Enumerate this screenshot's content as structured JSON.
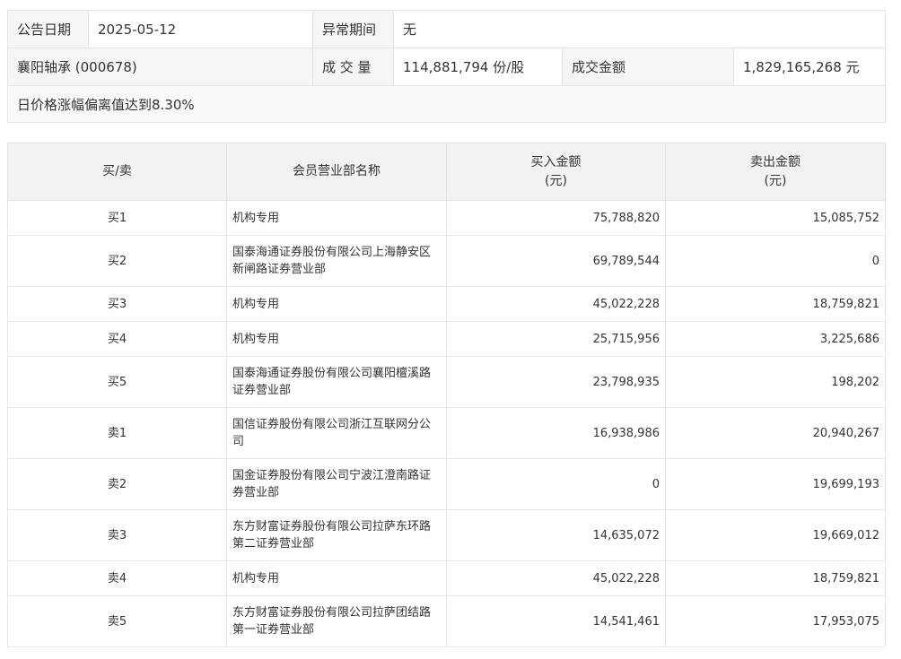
{
  "header": {
    "announce_label": "公告日期",
    "announce_date": "2025-05-12",
    "abnormal_label": "异常期间",
    "abnormal_value": "无",
    "stock_name": "襄阳轴承 (000678)",
    "volume_label": "成 交 量",
    "volume_value": "114,881,794 份/股",
    "amount_label": "成交金额",
    "amount_value": "1,829,165,268 元",
    "reason": "日价格涨幅偏离值达到8.30%"
  },
  "table": {
    "columns": {
      "type": "买/卖",
      "dept": "会员营业部名称",
      "buy": "买入金额",
      "buy_unit": "(元)",
      "sell": "卖出金额",
      "sell_unit": "(元)"
    },
    "rows": [
      {
        "type": "买1",
        "dept": "机构专用",
        "buy": "75,788,820",
        "sell": "15,085,752"
      },
      {
        "type": "买2",
        "dept": "国泰海通证券股份有限公司上海静安区新闸路证券营业部",
        "buy": "69,789,544",
        "sell": "0"
      },
      {
        "type": "买3",
        "dept": "机构专用",
        "buy": "45,022,228",
        "sell": "18,759,821"
      },
      {
        "type": "买4",
        "dept": "机构专用",
        "buy": "25,715,956",
        "sell": "3,225,686"
      },
      {
        "type": "买5",
        "dept": "国泰海通证券股份有限公司襄阳檀溪路证券营业部",
        "buy": "23,798,935",
        "sell": "198,202"
      },
      {
        "type": "卖1",
        "dept": "国信证券股份有限公司浙江互联网分公司",
        "buy": "16,938,986",
        "sell": "20,940,267"
      },
      {
        "type": "卖2",
        "dept": "国金证券股份有限公司宁波江澄南路证券营业部",
        "buy": "0",
        "sell": "19,699,193"
      },
      {
        "type": "卖3",
        "dept": "东方财富证券股份有限公司拉萨东环路第二证券营业部",
        "buy": "14,635,072",
        "sell": "19,669,012"
      },
      {
        "type": "卖4",
        "dept": "机构专用",
        "buy": "45,022,228",
        "sell": "18,759,821"
      },
      {
        "type": "卖5",
        "dept": "东方财富证券股份有限公司拉萨团结路第一证券营业部",
        "buy": "14,541,461",
        "sell": "17,953,075"
      }
    ]
  }
}
